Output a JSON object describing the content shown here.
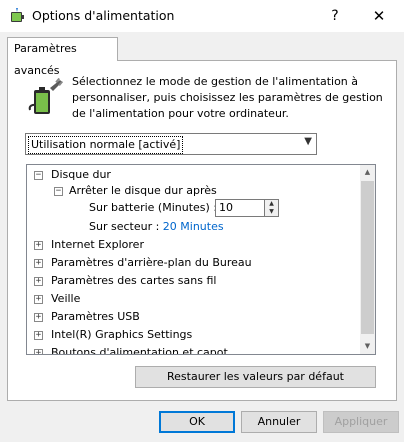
{
  "window": {
    "title": "Options d'alimentation",
    "help_glyph": "?",
    "close_glyph": "✕"
  },
  "tab": {
    "label": "Paramètres avancés"
  },
  "description": "Sélectionnez le mode de gestion de l'alimentation à personnaliser, puis choisissez les paramètres de gestion de l'alimentation pour votre ordinateur.",
  "plan_select": {
    "value": "Utilisation normale [activé]"
  },
  "tree": {
    "hard_disk": "Disque dur",
    "turn_off_disk": "Arrêter le disque dur après",
    "on_battery_label": "Sur batterie (Minutes) :",
    "on_battery_value": "10",
    "plugged_in_label": "Sur secteur :",
    "plugged_in_value": "20 Minutes",
    "items": [
      "Internet Explorer",
      "Paramètres d'arrière-plan du Bureau",
      "Paramètres des cartes sans fil",
      "Veille",
      "Paramètres USB",
      "Intel(R) Graphics Settings",
      "Boutons d'alimentation et capot"
    ]
  },
  "buttons": {
    "restore": "Restaurer les valeurs par défaut",
    "ok": "OK",
    "cancel": "Annuler",
    "apply": "Appliquer"
  },
  "colors": {
    "link": "#0066cc",
    "accent": "#0078d7"
  }
}
